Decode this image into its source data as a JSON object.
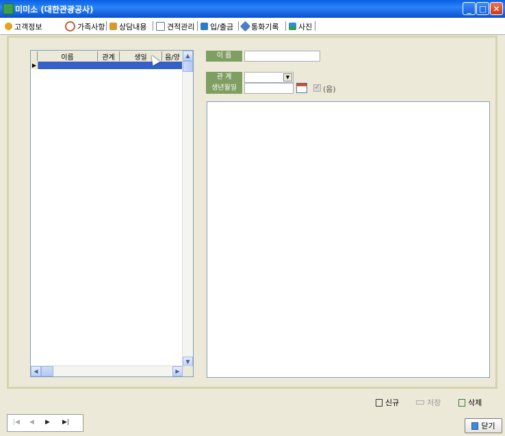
{
  "window": {
    "title": "미미소  (대한관광공사)"
  },
  "tabs": [
    {
      "label": "고객정보",
      "icon": "person-icon",
      "color": "#e8a21c"
    },
    {
      "label": "가족사항",
      "icon": "family-icon",
      "color": "#c9552f"
    },
    {
      "label": "상담내용",
      "icon": "consult-icon",
      "color": "#d49a2a"
    },
    {
      "label": "견적관리",
      "icon": "document-icon",
      "color": "#5d6f8a"
    },
    {
      "label": "입/출금",
      "icon": "money-icon",
      "color": "#2e7ac4"
    },
    {
      "label": "통화기록",
      "icon": "phone-icon",
      "color": "#4a7fc8"
    },
    {
      "label": "사진",
      "icon": "photo-icon",
      "color": "#2d8fd6"
    }
  ],
  "grid": {
    "columns": [
      "이름",
      "관계",
      "생일",
      "음/양"
    ],
    "row_indicator": "▶"
  },
  "form": {
    "name_label": "이    름",
    "relation_label": "관    계",
    "birthday_label": "생년월일",
    "lunar_label": "(음)"
  },
  "actions": {
    "new_label": "신규",
    "save_label": "저장",
    "delete_label": "삭제"
  },
  "nav": {
    "first": "|◀",
    "prev": "◀",
    "next": "▶",
    "last": "▶|"
  },
  "close_label": "닫기"
}
